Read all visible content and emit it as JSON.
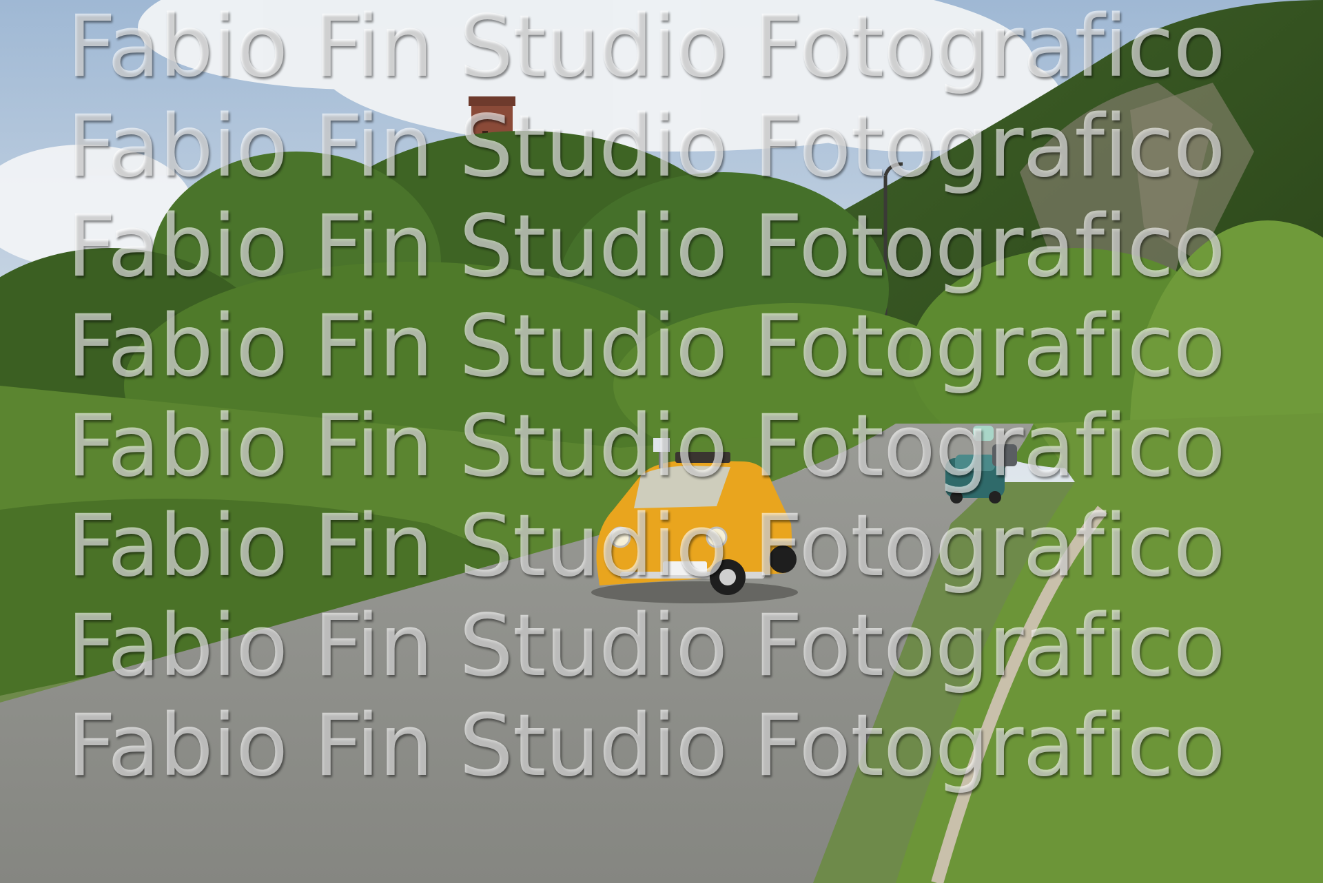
{
  "photo": {
    "subject": "yellow-vintage-car-on-country-road",
    "palette": {
      "sky": "#b9cde0",
      "cloud": "#f2f4f6",
      "foliage_dark": "#2f4a1c",
      "foliage_mid": "#4f7a2a",
      "foliage_light": "#8bb04a",
      "rock": "#7d7a68",
      "road": "#8f8f8a",
      "tower": "#8a4a38",
      "car_yellow": "#e9a51e",
      "car_teal": "#2f6a6a"
    }
  },
  "watermark": {
    "text": "Fabio Fin Studio Fotografico",
    "lines": [
      "Fabio Fin Studio Fotografico",
      "Fabio Fin Studio Fotografico",
      "Fabio Fin Studio Fotografico",
      "Fabio Fin Studio Fotografico",
      "Fabio Fin Studio Fotografico",
      "Fabio Fin Studio Fotografico",
      "Fabio Fin Studio Fotografico",
      "Fabio Fin Studio Fotografico"
    ]
  }
}
